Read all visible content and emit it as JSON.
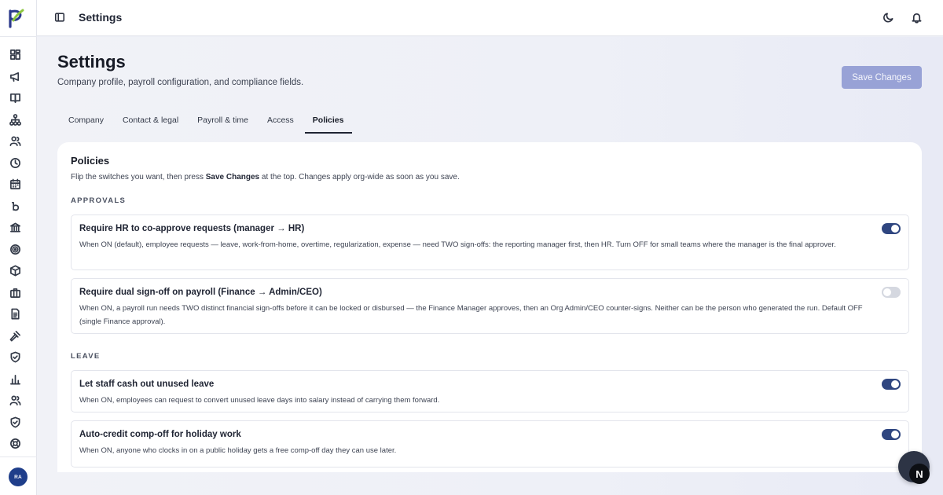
{
  "topbar": {
    "title": "Settings"
  },
  "user": {
    "initials": "RA"
  },
  "page": {
    "title": "Settings",
    "subtitle": "Company profile, payroll configuration, and compliance fields.",
    "save_label": "Save Changes"
  },
  "tabs": [
    {
      "label": "Company",
      "active": false
    },
    {
      "label": "Contact & legal",
      "active": false
    },
    {
      "label": "Payroll & time",
      "active": false
    },
    {
      "label": "Access",
      "active": false
    },
    {
      "label": "Policies",
      "active": true
    }
  ],
  "card": {
    "title": "Policies",
    "desc_pre": "Flip the switches you want, then press ",
    "desc_bold": "Save Changes",
    "desc_post": " at the top. Changes apply org-wide as soon as you save."
  },
  "sections": {
    "approvals": "APPROVALS",
    "leave": "LEAVE"
  },
  "policies": [
    {
      "title": "Require HR to co-approve requests (manager → HR)",
      "desc": "When ON (default), employee requests — leave, work-from-home, overtime, regularization, expense — need TWO sign-offs: the reporting manager first, then HR. Turn OFF for small teams where the manager is the final approver.",
      "enabled": true
    },
    {
      "title": "Require dual sign-off on payroll (Finance → Admin/CEO)",
      "desc": "When ON, a payroll run needs TWO distinct financial sign-offs before it can be locked or disbursed — the Finance Manager approves, then an Org Admin/CEO counter-signs. Neither can be the person who generated the run. Default OFF (single Finance approval).",
      "enabled": false
    },
    {
      "title": "Let staff cash out unused leave",
      "desc": "When ON, employees can request to convert unused leave days into salary instead of carrying them forward.",
      "enabled": true
    },
    {
      "title": "Auto-credit comp-off for holiday work",
      "desc": "When ON, anyone who clocks in on a public holiday gets a free comp-off day they can use later.",
      "enabled": true
    }
  ],
  "fab": {
    "badge": "N"
  },
  "colors": {
    "accent": "#2f4680",
    "save_button": "#98a2d6",
    "avatar": "#1f3e8a"
  }
}
